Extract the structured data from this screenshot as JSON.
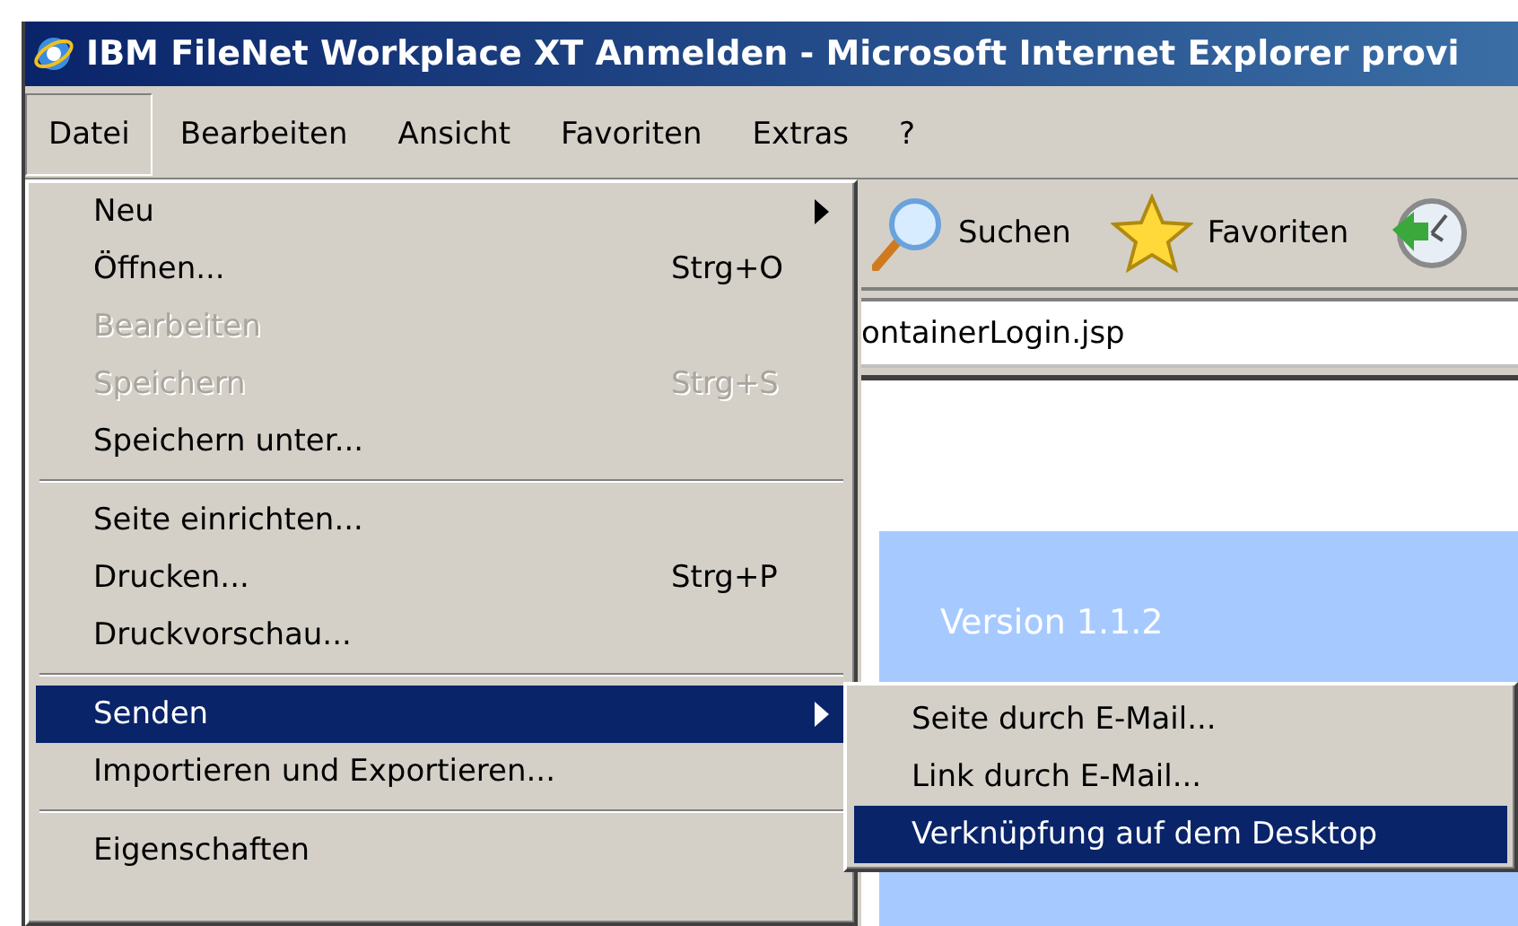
{
  "window": {
    "title": "IBM FileNet Workplace XT Anmelden - Microsoft Internet Explorer provi"
  },
  "menubar": [
    {
      "label": "Datei",
      "selected": true
    },
    {
      "label": "Bearbeiten",
      "selected": false
    },
    {
      "label": "Ansicht",
      "selected": false
    },
    {
      "label": "Favoriten",
      "selected": false
    },
    {
      "label": "Extras",
      "selected": false
    },
    {
      "label": "?",
      "selected": false
    }
  ],
  "toolbar": {
    "buttons": [
      {
        "kind": "search",
        "label": "Suchen"
      },
      {
        "kind": "favorites",
        "label": "Favoriten"
      },
      {
        "kind": "history"
      }
    ]
  },
  "address_bar": {
    "value": "ontainerLogin.jsp"
  },
  "page": {
    "version": "Version 1.1.2"
  },
  "file_menu": {
    "items": [
      {
        "kind": "item",
        "label": "Neu",
        "submenu": true,
        "disabled": false,
        "selected": false
      },
      {
        "kind": "item",
        "label": "Öffnen...",
        "shortcut": "Strg+O",
        "submenu": false,
        "disabled": false,
        "selected": false
      },
      {
        "kind": "item",
        "label": "Bearbeiten",
        "submenu": false,
        "disabled": true,
        "selected": false
      },
      {
        "kind": "item",
        "label": "Speichern",
        "shortcut": "Strg+S",
        "submenu": false,
        "disabled": true,
        "selected": false
      },
      {
        "kind": "item",
        "label": "Speichern unter...",
        "submenu": false,
        "disabled": false,
        "selected": false
      },
      {
        "kind": "separator"
      },
      {
        "kind": "item",
        "label": "Seite einrichten...",
        "submenu": false,
        "disabled": false,
        "selected": false
      },
      {
        "kind": "item",
        "label": "Drucken...",
        "shortcut": "Strg+P",
        "submenu": false,
        "disabled": false,
        "selected": false
      },
      {
        "kind": "item",
        "label": "Druckvorschau...",
        "submenu": false,
        "disabled": false,
        "selected": false
      },
      {
        "kind": "separator"
      },
      {
        "kind": "item",
        "label": "Senden",
        "submenu": true,
        "disabled": false,
        "selected": true
      },
      {
        "kind": "item",
        "label": "Importieren und Exportieren...",
        "submenu": false,
        "disabled": false,
        "selected": false
      },
      {
        "kind": "separator"
      },
      {
        "kind": "item",
        "label": "Eigenschaften",
        "submenu": false,
        "disabled": false,
        "selected": false
      }
    ]
  },
  "send_submenu": {
    "items": [
      {
        "label": "Seite durch E-Mail...",
        "selected": false
      },
      {
        "label": "Link durch E-Mail...",
        "selected": false
      },
      {
        "label": "Verknüpfung auf dem Desktop",
        "selected": true
      }
    ]
  }
}
